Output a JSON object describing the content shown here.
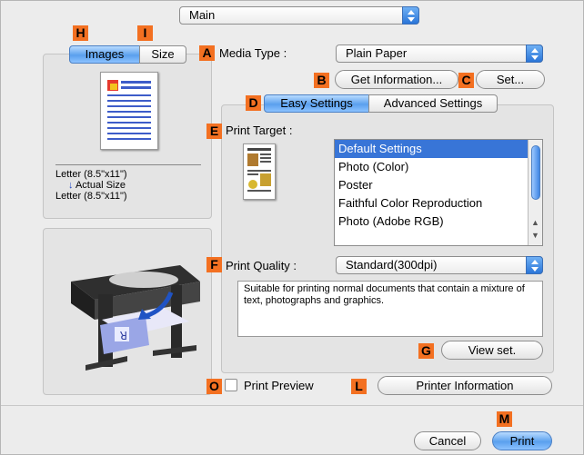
{
  "main_popup": {
    "value": "Main"
  },
  "markers": {
    "H": "H",
    "I": "I",
    "A": "A",
    "B": "B",
    "C": "C",
    "D": "D",
    "E": "E",
    "F": "F",
    "G": "G",
    "O": "O",
    "L": "L",
    "M": "M"
  },
  "preview_tabs": {
    "images": "Images",
    "size": "Size",
    "selected": "Images"
  },
  "paper_info": {
    "line1": "Letter (8.5\"x11\")",
    "line2": "Actual Size",
    "line3": "Letter (8.5\"x11\")"
  },
  "media_type": {
    "label": "Media Type :",
    "value": "Plain Paper"
  },
  "buttons": {
    "get_information": "Get Information...",
    "set": "Set...",
    "view_set": "View set.",
    "printer_information": "Printer Information",
    "cancel": "Cancel",
    "print": "Print"
  },
  "settings_tabs": {
    "easy": "Easy Settings",
    "advanced": "Advanced Settings",
    "selected": "Easy Settings"
  },
  "print_target": {
    "label": "Print Target :",
    "options": [
      "Default Settings",
      "Photo (Color)",
      "Poster",
      "Faithful Color Reproduction",
      "Photo (Adobe RGB)"
    ],
    "selected": "Default Settings"
  },
  "print_quality": {
    "label": "Print Quality :",
    "value": "Standard(300dpi)"
  },
  "description": "Suitable for printing normal documents that contain a mixture of text, photographs and graphics.",
  "print_preview": {
    "label": "Print Preview",
    "checked": false
  },
  "colors": {
    "marker": "#f37021",
    "accent_blue": "#3875d7"
  }
}
